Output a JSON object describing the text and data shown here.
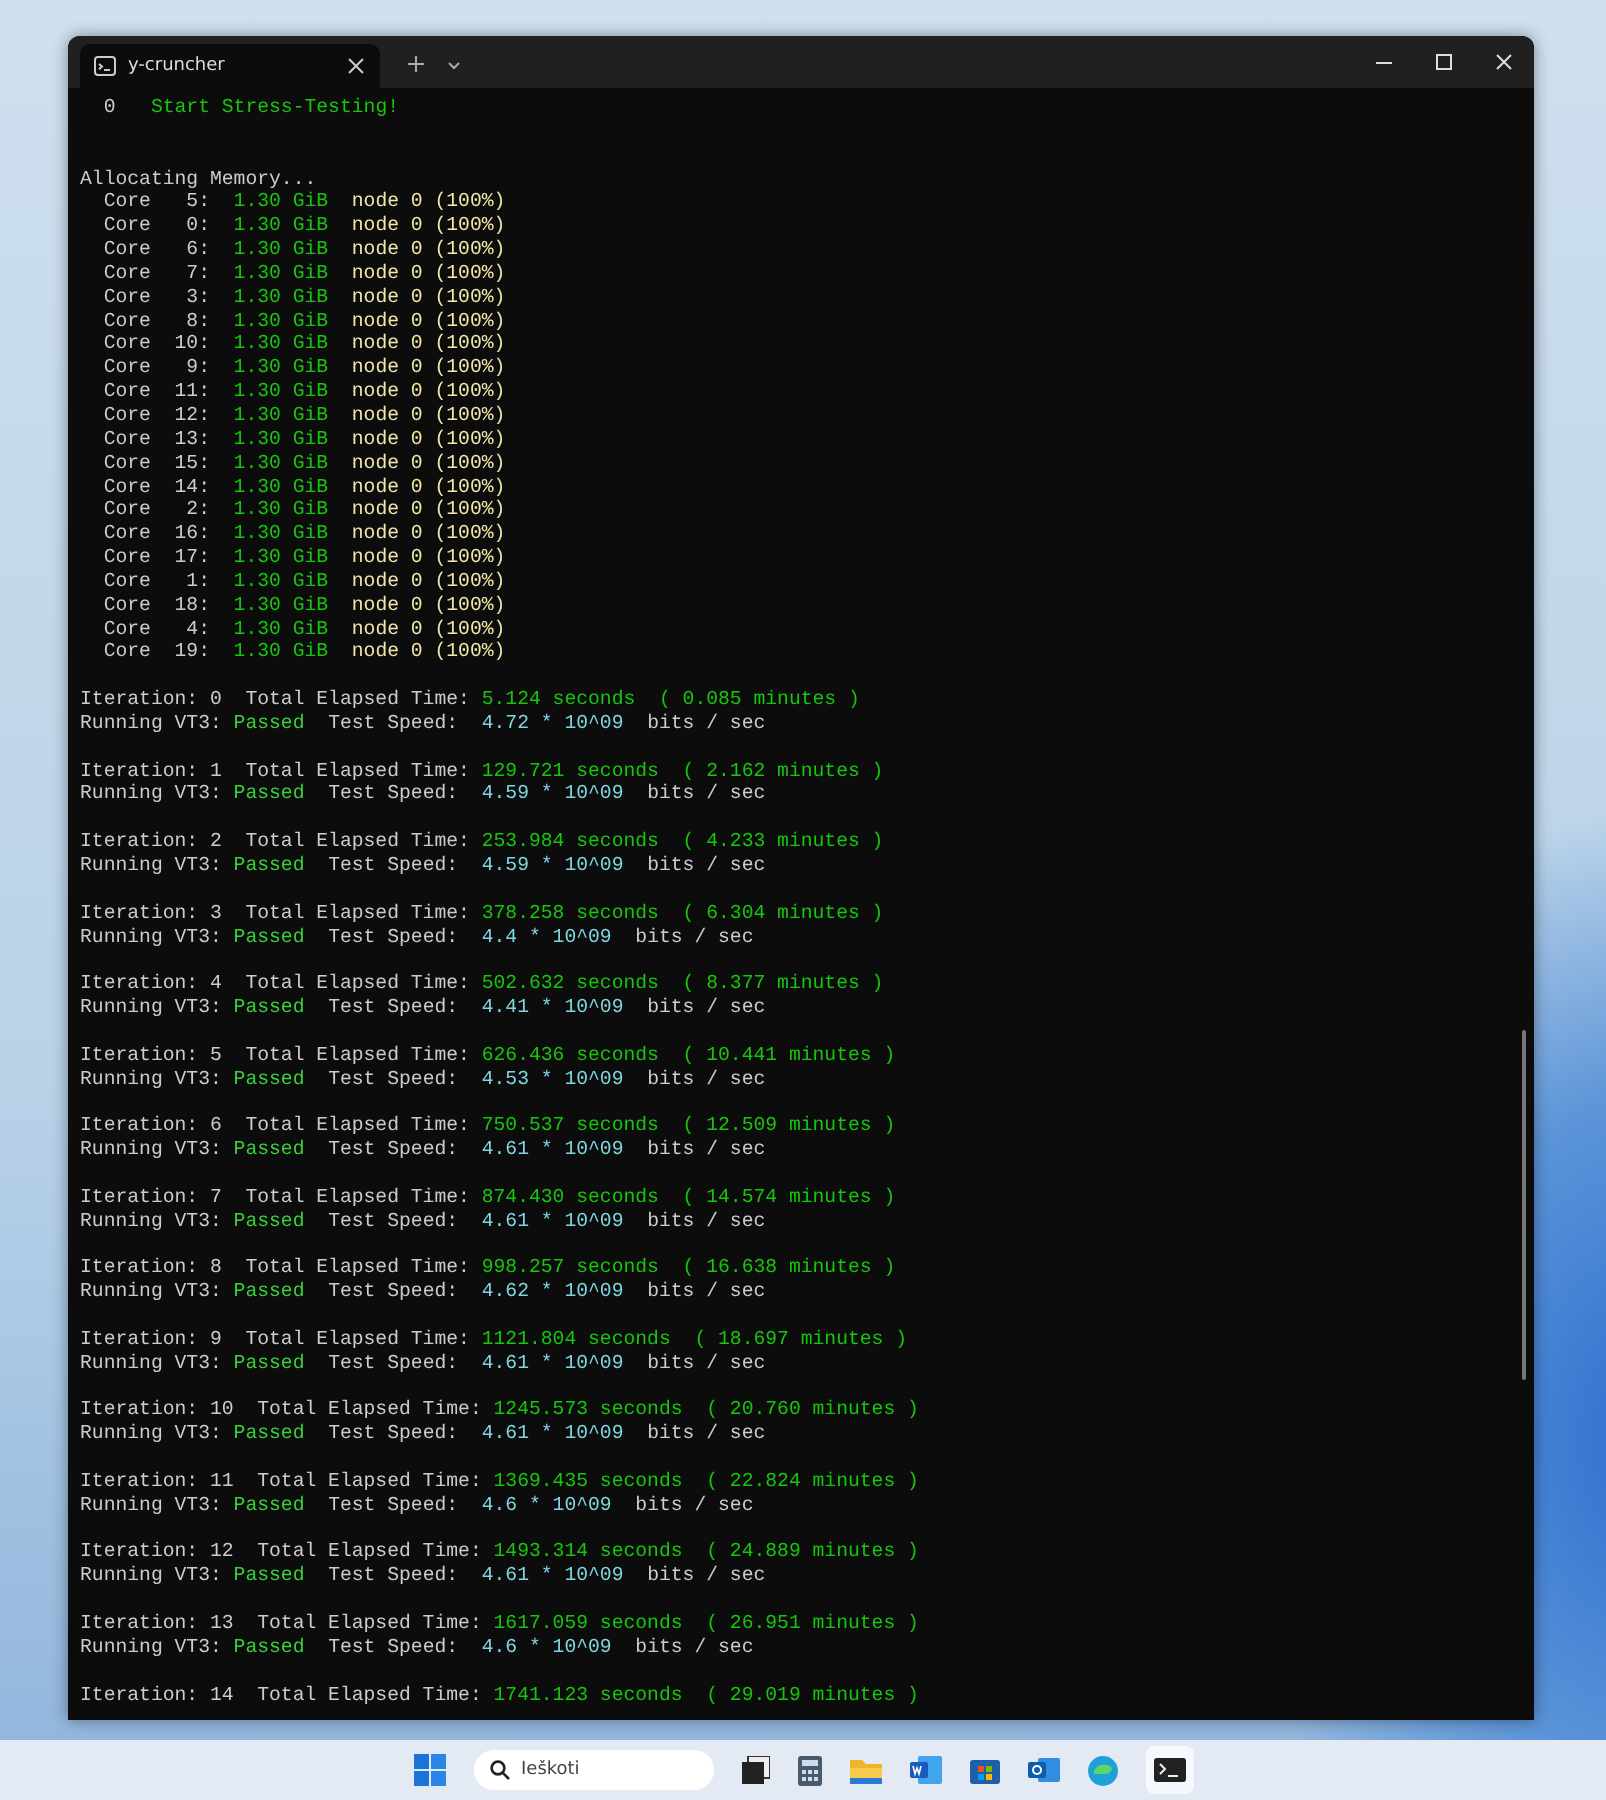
{
  "window": {
    "tab_title": "y-cruncher"
  },
  "start": {
    "index": "0",
    "text": "Start Stress-Testing!"
  },
  "allocating": "Allocating Memory...",
  "cores": [
    {
      "label": "Core   5:",
      "size": "1.30 GiB",
      "node": "node 0 (100%)"
    },
    {
      "label": "Core   0:",
      "size": "1.30 GiB",
      "node": "node 0 (100%)"
    },
    {
      "label": "Core   6:",
      "size": "1.30 GiB",
      "node": "node 0 (100%)"
    },
    {
      "label": "Core   7:",
      "size": "1.30 GiB",
      "node": "node 0 (100%)"
    },
    {
      "label": "Core   3:",
      "size": "1.30 GiB",
      "node": "node 0 (100%)"
    },
    {
      "label": "Core   8:",
      "size": "1.30 GiB",
      "node": "node 0 (100%)"
    },
    {
      "label": "Core  10:",
      "size": "1.30 GiB",
      "node": "node 0 (100%)"
    },
    {
      "label": "Core   9:",
      "size": "1.30 GiB",
      "node": "node 0 (100%)"
    },
    {
      "label": "Core  11:",
      "size": "1.30 GiB",
      "node": "node 0 (100%)"
    },
    {
      "label": "Core  12:",
      "size": "1.30 GiB",
      "node": "node 0 (100%)"
    },
    {
      "label": "Core  13:",
      "size": "1.30 GiB",
      "node": "node 0 (100%)"
    },
    {
      "label": "Core  15:",
      "size": "1.30 GiB",
      "node": "node 0 (100%)"
    },
    {
      "label": "Core  14:",
      "size": "1.30 GiB",
      "node": "node 0 (100%)"
    },
    {
      "label": "Core   2:",
      "size": "1.30 GiB",
      "node": "node 0 (100%)"
    },
    {
      "label": "Core  16:",
      "size": "1.30 GiB",
      "node": "node 0 (100%)"
    },
    {
      "label": "Core  17:",
      "size": "1.30 GiB",
      "node": "node 0 (100%)"
    },
    {
      "label": "Core   1:",
      "size": "1.30 GiB",
      "node": "node 0 (100%)"
    },
    {
      "label": "Core  18:",
      "size": "1.30 GiB",
      "node": "node 0 (100%)"
    },
    {
      "label": "Core   4:",
      "size": "1.30 GiB",
      "node": "node 0 (100%)"
    },
    {
      "label": "Core  19:",
      "size": "1.30 GiB",
      "node": "node 0 (100%)"
    }
  ],
  "iterations": [
    {
      "heading": "Iteration: 0  Total Elapsed Time:",
      "elapsed": "5.124 seconds  ( 0.085 minutes )",
      "test": "Running VT3:",
      "result": "Passed",
      "speed_label": "Test Speed:",
      "speed": "4.72 * 10^09",
      "unit": "bits / sec"
    },
    {
      "heading": "Iteration: 1  Total Elapsed Time:",
      "elapsed": "129.721 seconds  ( 2.162 minutes )",
      "test": "Running VT3:",
      "result": "Passed",
      "speed_label": "Test Speed:",
      "speed": "4.59 * 10^09",
      "unit": "bits / sec"
    },
    {
      "heading": "Iteration: 2  Total Elapsed Time:",
      "elapsed": "253.984 seconds  ( 4.233 minutes )",
      "test": "Running VT3:",
      "result": "Passed",
      "speed_label": "Test Speed:",
      "speed": "4.59 * 10^09",
      "unit": "bits / sec"
    },
    {
      "heading": "Iteration: 3  Total Elapsed Time:",
      "elapsed": "378.258 seconds  ( 6.304 minutes )",
      "test": "Running VT3:",
      "result": "Passed",
      "speed_label": "Test Speed:",
      "speed": "4.4 * 10^09",
      "unit": "bits / sec"
    },
    {
      "heading": "Iteration: 4  Total Elapsed Time:",
      "elapsed": "502.632 seconds  ( 8.377 minutes )",
      "test": "Running VT3:",
      "result": "Passed",
      "speed_label": "Test Speed:",
      "speed": "4.41 * 10^09",
      "unit": "bits / sec"
    },
    {
      "heading": "Iteration: 5  Total Elapsed Time:",
      "elapsed": "626.436 seconds  ( 10.441 minutes )",
      "test": "Running VT3:",
      "result": "Passed",
      "speed_label": "Test Speed:",
      "speed": "4.53 * 10^09",
      "unit": "bits / sec"
    },
    {
      "heading": "Iteration: 6  Total Elapsed Time:",
      "elapsed": "750.537 seconds  ( 12.509 minutes )",
      "test": "Running VT3:",
      "result": "Passed",
      "speed_label": "Test Speed:",
      "speed": "4.61 * 10^09",
      "unit": "bits / sec"
    },
    {
      "heading": "Iteration: 7  Total Elapsed Time:",
      "elapsed": "874.430 seconds  ( 14.574 minutes )",
      "test": "Running VT3:",
      "result": "Passed",
      "speed_label": "Test Speed:",
      "speed": "4.61 * 10^09",
      "unit": "bits / sec"
    },
    {
      "heading": "Iteration: 8  Total Elapsed Time:",
      "elapsed": "998.257 seconds  ( 16.638 minutes )",
      "test": "Running VT3:",
      "result": "Passed",
      "speed_label": "Test Speed:",
      "speed": "4.62 * 10^09",
      "unit": "bits / sec"
    },
    {
      "heading": "Iteration: 9  Total Elapsed Time:",
      "elapsed": "1121.804 seconds  ( 18.697 minutes )",
      "test": "Running VT3:",
      "result": "Passed",
      "speed_label": "Test Speed:",
      "speed": "4.61 * 10^09",
      "unit": "bits / sec"
    },
    {
      "heading": "Iteration: 10  Total Elapsed Time:",
      "elapsed": "1245.573 seconds  ( 20.760 minutes )",
      "test": "Running VT3:",
      "result": "Passed",
      "speed_label": "Test Speed:",
      "speed": "4.61 * 10^09",
      "unit": "bits / sec"
    },
    {
      "heading": "Iteration: 11  Total Elapsed Time:",
      "elapsed": "1369.435 seconds  ( 22.824 minutes )",
      "test": "Running VT3:",
      "result": "Passed",
      "speed_label": "Test Speed:",
      "speed": "4.6 * 10^09",
      "unit": "bits / sec"
    },
    {
      "heading": "Iteration: 12  Total Elapsed Time:",
      "elapsed": "1493.314 seconds  ( 24.889 minutes )",
      "test": "Running VT3:",
      "result": "Passed",
      "speed_label": "Test Speed:",
      "speed": "4.61 * 10^09",
      "unit": "bits / sec"
    },
    {
      "heading": "Iteration: 13  Total Elapsed Time:",
      "elapsed": "1617.059 seconds  ( 26.951 minutes )",
      "test": "Running VT3:",
      "result": "Passed",
      "speed_label": "Test Speed:",
      "speed": "4.6 * 10^09",
      "unit": "bits / sec"
    },
    {
      "heading": "Iteration: 14  Total Elapsed Time:",
      "elapsed": "1741.123 seconds  ( 29.019 minutes )"
    }
  ],
  "taskbar": {
    "search": {
      "placeholder": "Ieškoti"
    }
  }
}
